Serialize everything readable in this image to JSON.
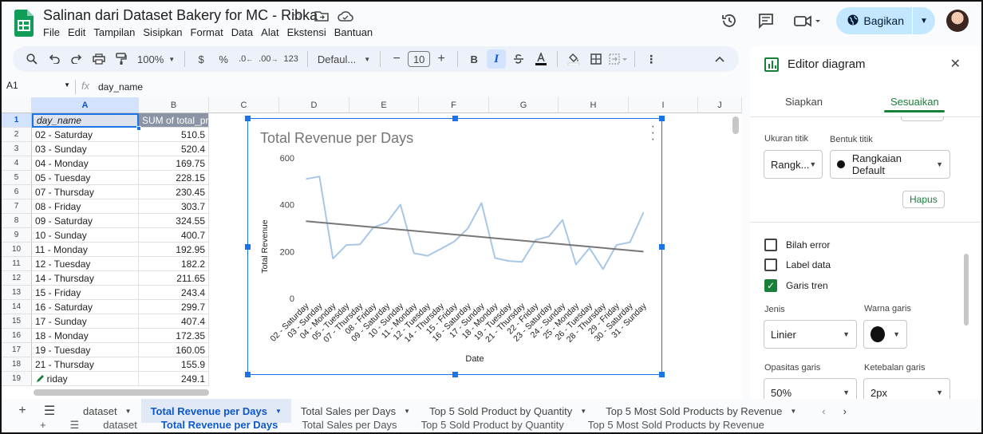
{
  "doc": {
    "title": "Salinan dari Dataset Bakery for MC - Ribka"
  },
  "menu": [
    "File",
    "Edit",
    "Tampilan",
    "Sisipkan",
    "Format",
    "Data",
    "Alat",
    "Ekstensi",
    "Bantuan"
  ],
  "share_label": "Bagikan",
  "toolbar": {
    "zoom": "100%",
    "currency": "$",
    "percent": "%",
    "dec_decrease": ".0",
    "dec_increase": ".00",
    "number_format": "123",
    "font": "Defaul...",
    "font_size": "10",
    "bold": "B",
    "italic": "I"
  },
  "formula_bar": {
    "cell_ref": "A1",
    "fx": "fx",
    "content": "day_name"
  },
  "grid": {
    "columns": [
      "A",
      "B",
      "C",
      "D",
      "E",
      "F",
      "G",
      "H",
      "I",
      "J"
    ],
    "header": {
      "a": "day_name",
      "b": "SUM of total_price"
    },
    "row_numbers": [
      "1",
      "2",
      "3",
      "4",
      "5",
      "6",
      "7",
      "8",
      "9",
      "10",
      "11",
      "12",
      "13",
      "14",
      "15",
      "16",
      "17",
      "18",
      "19"
    ],
    "rows": [
      {
        "day": "02 - Saturday",
        "sum": "510.5"
      },
      {
        "day": "03 - Sunday",
        "sum": "520.4"
      },
      {
        "day": "04 - Monday",
        "sum": "169.75"
      },
      {
        "day": "05 - Tuesday",
        "sum": "228.15"
      },
      {
        "day": "07 - Thursday",
        "sum": "230.45"
      },
      {
        "day": "08 - Friday",
        "sum": "303.7"
      },
      {
        "day": "09 - Saturday",
        "sum": "324.55"
      },
      {
        "day": "10 - Sunday",
        "sum": "400.7"
      },
      {
        "day": "11 - Monday",
        "sum": "192.95"
      },
      {
        "day": "12 - Tuesday",
        "sum": "182.2"
      },
      {
        "day": "14 - Thursday",
        "sum": "211.65"
      },
      {
        "day": "15 - Friday",
        "sum": "243.4"
      },
      {
        "day": "16 - Saturday",
        "sum": "299.7"
      },
      {
        "day": "17 - Sunday",
        "sum": "407.4"
      },
      {
        "day": "18 - Monday",
        "sum": "172.35"
      },
      {
        "day": "19 - Tuesday",
        "sum": "160.05"
      },
      {
        "day": "21 - Thursday",
        "sum": "155.9"
      },
      {
        "day": "- Friday",
        "sum": "249.1"
      }
    ]
  },
  "chart_data": {
    "type": "line",
    "title": "Total Revenue per Days",
    "xlabel": "Date",
    "ylabel": "Total Revenue",
    "ylim": [
      0,
      600
    ],
    "yticks": [
      0,
      200,
      400,
      600
    ],
    "categories": [
      "02 - Saturday",
      "03 - Sunday",
      "04 - Monday",
      "05 - Tuesday",
      "07 - Thursday",
      "08 - Friday",
      "09 - Saturday",
      "10 - Sunday",
      "11 - Monday",
      "12 - Tuesday",
      "14 - Thursday",
      "15 - Friday",
      "16 - Saturday",
      "17 - Sunday",
      "18 - Monday",
      "19 - Tuesday",
      "21 - Thursday",
      "22 - Friday",
      "23 - Saturday",
      "24 - Sunday",
      "25 - Monday",
      "26 - Tuesday",
      "28 - Thursday",
      "29 - Friday",
      "30 - Saturday",
      "31 - Sunday"
    ],
    "series": [
      {
        "values": [
          510.5,
          520.4,
          169.75,
          228.15,
          230.45,
          303.7,
          324.55,
          400.7,
          192.95,
          182.2,
          211.65,
          243.4,
          299.7,
          407.4,
          172.35,
          160.05,
          155.9,
          249.1,
          265,
          335,
          145,
          215,
          125,
          228,
          240,
          368
        ],
        "color": "#a8c7e6"
      }
    ],
    "trendline": {
      "type": "linear",
      "start": 330,
      "end": 200,
      "color": "#777777"
    },
    "legend": "none",
    "grid": false
  },
  "panel": {
    "title": "Editor diagram",
    "tab_setup": "Siapkan",
    "tab_customize": "Sesuaikan",
    "point_size_label": "Ukuran titik",
    "point_size_value": "Rangk...",
    "point_shape_label": "Bentuk titik",
    "point_shape_value": "Rangkaian Default",
    "delete_label": "Hapus",
    "error_bars": "Bilah error",
    "data_labels": "Label data",
    "trendline": "Garis tren",
    "type_label": "Jenis",
    "type_value": "Linier",
    "line_color_label": "Warna garis",
    "line_opacity_label": "Opasitas garis",
    "line_opacity_value": "50%",
    "line_thickness_label": "Ketebalan garis",
    "line_thickness_value": "2px"
  },
  "sheets": [
    {
      "name": "dataset"
    },
    {
      "name": "Total Revenue per Days"
    },
    {
      "name": "Total Sales per Days"
    },
    {
      "name": "Top 5 Sold Product by Quantity"
    },
    {
      "name": "Top 5 Most Sold Products by Revenue"
    }
  ],
  "colors": {
    "accent": "#1a73e8",
    "green": "#188038",
    "share_bg": "#c2e7ff"
  }
}
